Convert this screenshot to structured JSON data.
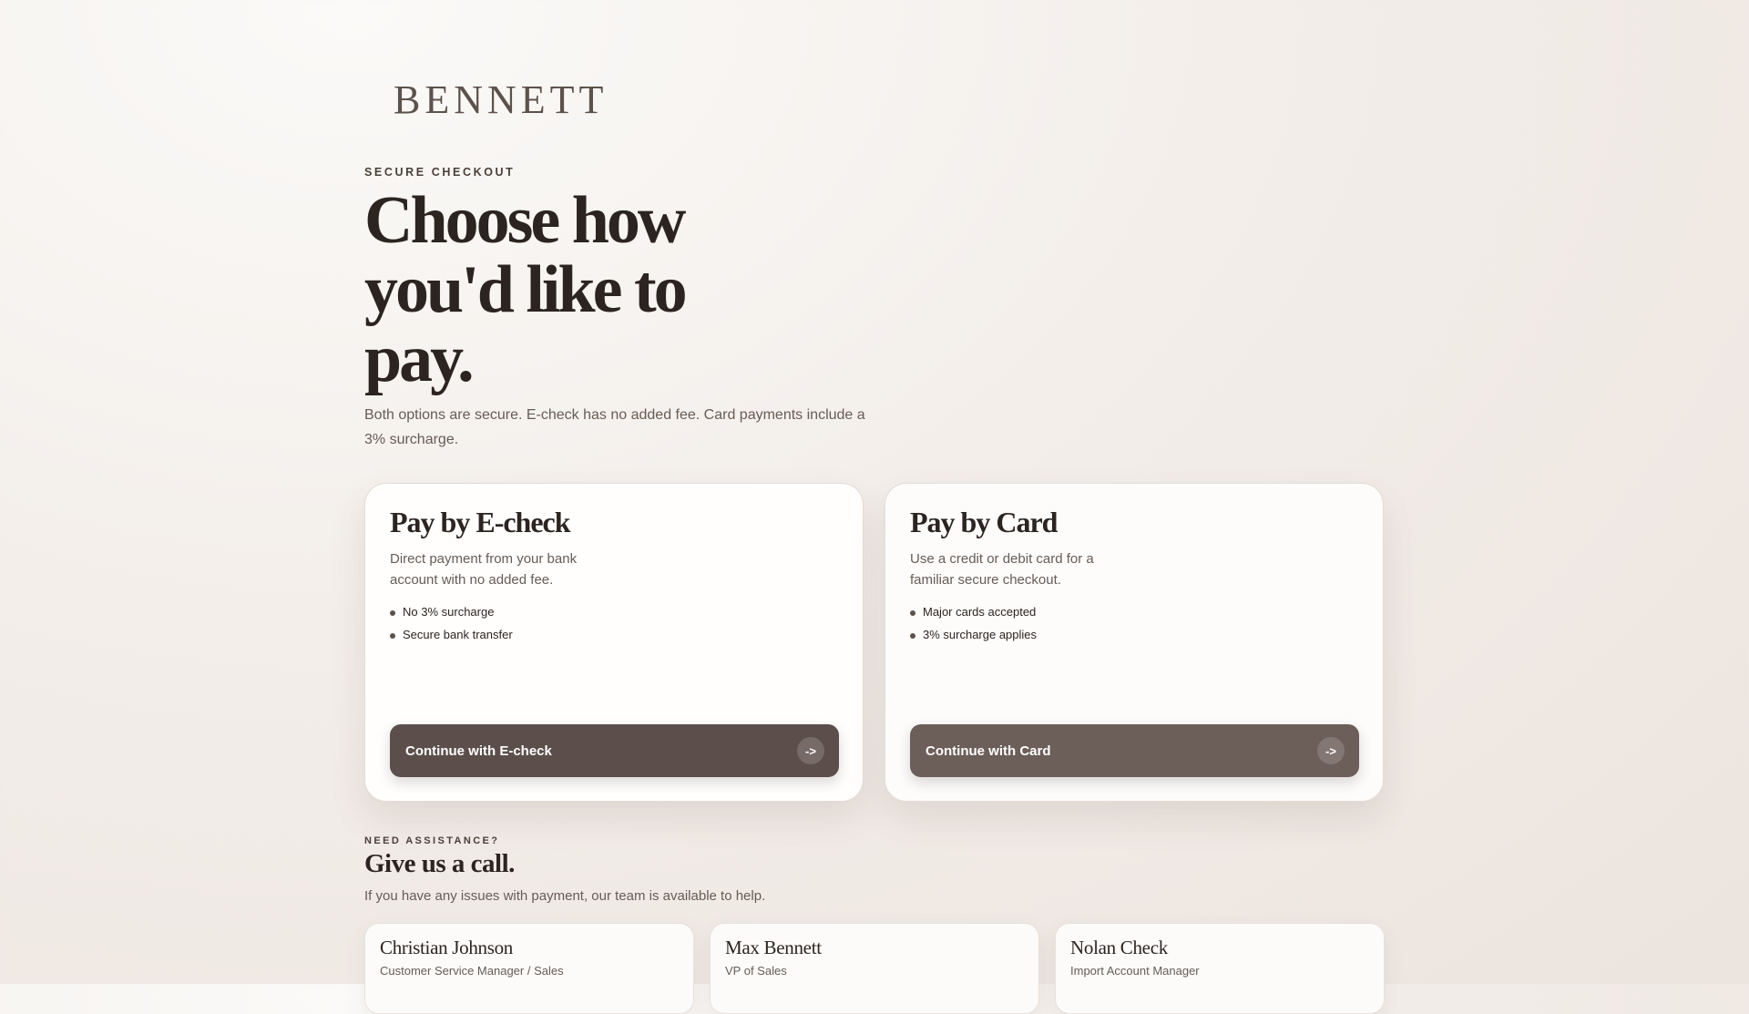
{
  "brand": {
    "logo_text": "BENNETT"
  },
  "hero": {
    "eyebrow": "SECURE CHECKOUT",
    "headline": "Choose how you'd like to pay.",
    "subtext": "Both options are secure. E-check has no added fee. Card payments include a 3% surcharge."
  },
  "options": [
    {
      "title": "Pay by E-check",
      "description": "Direct payment from your bank account with no added fee.",
      "features": [
        "No 3% surcharge",
        "Secure bank transfer"
      ],
      "button_label": "Continue with E-check",
      "button_icon": "->",
      "button_color": "#5c4f4b"
    },
    {
      "title": "Pay by Card",
      "description": "Use a credit or debit card for a familiar secure checkout.",
      "features": [
        "Major cards accepted",
        "3% surcharge applies"
      ],
      "button_label": "Continue with Card",
      "button_icon": "->",
      "button_color": "#6c5e59"
    }
  ],
  "assistance": {
    "eyebrow": "NEED ASSISTANCE?",
    "title": "Give us a call.",
    "subtext": "If you have any issues with payment, our team is available to help.",
    "contacts": [
      {
        "name": "Christian Johnson",
        "role": "Customer Service Manager / Sales"
      },
      {
        "name": "Max Bennett",
        "role": "VP of Sales"
      },
      {
        "name": "Nolan Check",
        "role": "Import Account Manager"
      }
    ]
  }
}
